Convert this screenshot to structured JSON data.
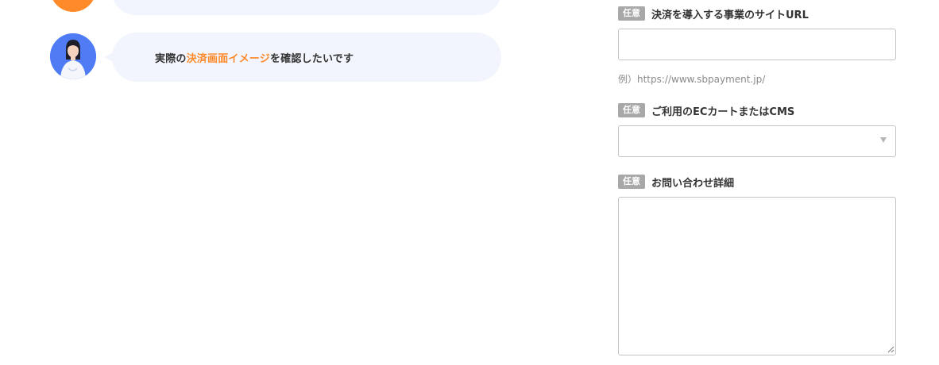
{
  "chat": {
    "bubble_prefix": "実際の",
    "bubble_highlight": "決済画面イメージ",
    "bubble_suffix": "を確認したいです",
    "highlight_color": "#ff8a2a",
    "bubble_color": "#f2f5fd"
  },
  "form": {
    "site_url": {
      "badge": "任意",
      "label": "決済を導入する事業のサイトURL",
      "value": "",
      "hint": "例）https://www.sbpayment.jp/"
    },
    "ec_cart": {
      "badge": "任意",
      "label": "ご利用のECカートまたはCMS",
      "selected": "",
      "icon": "chevron-down-icon"
    },
    "inquiry_detail": {
      "badge": "任意",
      "label": "お問い合わせ詳細",
      "value": ""
    }
  }
}
